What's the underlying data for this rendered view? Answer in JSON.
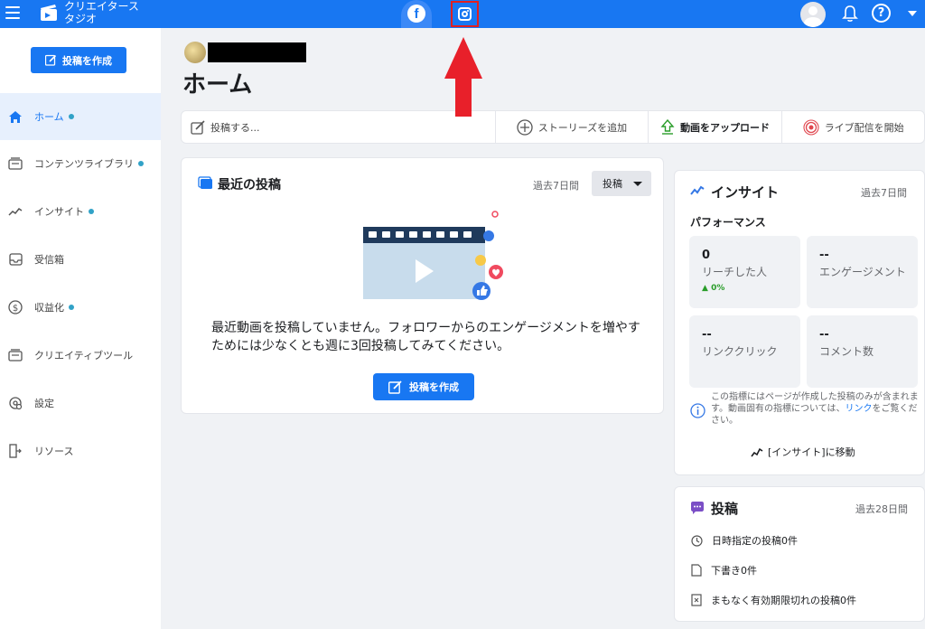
{
  "topbar": {
    "app_title": "クリエイタースタジオ",
    "icons": [
      "menu-icon",
      "creator-studio-logo-icon",
      "facebook-icon",
      "instagram-icon",
      "avatar-icon",
      "bell-icon",
      "help-icon",
      "caret-down-icon"
    ],
    "facebook_glyph": "f",
    "help_glyph": "?",
    "accent_color": "#1877f2"
  },
  "sidebar": {
    "create_button": "投稿を作成",
    "items": [
      {
        "label": "ホーム",
        "icon": "home-icon",
        "dot": true
      },
      {
        "label": "コンテンツライブラリ",
        "icon": "content-library-icon",
        "dot": true
      },
      {
        "label": "インサイト",
        "icon": "insights-icon",
        "dot": true
      },
      {
        "label": "受信箱",
        "icon": "inbox-icon",
        "dot": false
      },
      {
        "label": "収益化",
        "icon": "monetization-icon",
        "dot": true
      },
      {
        "label": "クリエイティブツール",
        "icon": "creative-tools-icon",
        "dot": false
      },
      {
        "label": "設定",
        "icon": "settings-icon",
        "dot": false
      },
      {
        "label": "リソース",
        "icon": "resources-icon",
        "dot": false
      }
    ]
  },
  "main": {
    "page_title": "ホーム",
    "actions": {
      "compose": "投稿する...",
      "add_story": "ストーリーズを追加",
      "upload_video": "動画をアップロード",
      "go_live": "ライブ配信を開始"
    },
    "recent_posts": {
      "title": "最近の投稿",
      "period": "過去7日間",
      "filter": "投稿",
      "empty_message": "最近動画を投稿していません。フォロワーからのエンゲージメントを増やすためには少なくとも週に3回投稿してみてください。",
      "create_button": "投稿を作成"
    }
  },
  "insights": {
    "title": "インサイト",
    "period": "過去7日間",
    "section": "パフォーマンス",
    "metrics": [
      {
        "value": "0",
        "label": "リーチした人",
        "change": "0%"
      },
      {
        "value": "--",
        "label": "エンゲージメント"
      },
      {
        "value": "--",
        "label": "リンククリック"
      },
      {
        "value": "--",
        "label": "コメント数"
      }
    ],
    "note_before": "この指標にはページが作成した投稿のみが含まれます。動画固有の指標については、",
    "note_link": "リンク",
    "note_after": "をご覧ください。",
    "goto": "[インサイト]に移動"
  },
  "posts_summary": {
    "title": "投稿",
    "period": "過去28日間",
    "lines": [
      "日時指定の投稿0件",
      "下書き0件",
      "まもなく有効期限切れの投稿0件"
    ]
  }
}
